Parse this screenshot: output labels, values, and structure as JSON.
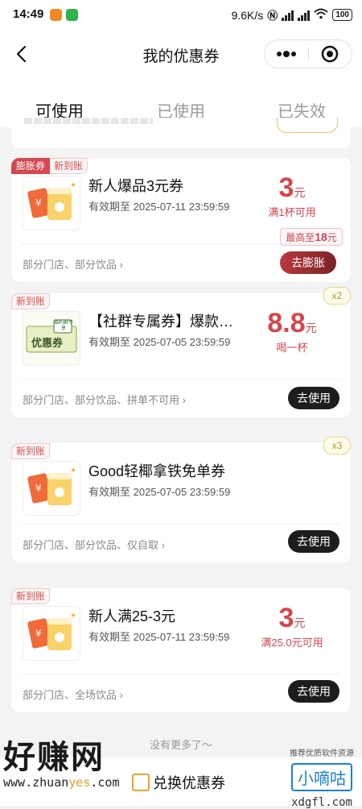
{
  "status_bar": {
    "time": "14:49",
    "net_speed": "9.6K/s",
    "battery": "100"
  },
  "nav": {
    "title": "我的优惠券"
  },
  "tabs": [
    {
      "label": "可使用",
      "active": true
    },
    {
      "label": "已使用",
      "active": false
    },
    {
      "label": "已失效",
      "active": false
    }
  ],
  "coupons": [
    {
      "tags": [
        "膨胀券",
        "新到账"
      ],
      "title": "新人爆品3元券",
      "validity": "有效期至 2025-07-11 23:59:59",
      "amount": "3",
      "unit": "元",
      "condition": "满1杯可用",
      "scope": "部分门店、部分饮品",
      "max_prefix": "最高至",
      "max_value": "18",
      "max_unit": "元",
      "button": "去膨胀",
      "icon": "cup-voucher-icon"
    },
    {
      "tags": [
        "新到账"
      ],
      "qty": "x2",
      "title": "【社群专属券】爆款…",
      "validity": "有效期至 2025-07-05 23:59:59",
      "amount": "8.8",
      "unit": "元",
      "condition": "喝一杯",
      "scope": "部分门店、部分饮品、拼单不可用",
      "thumb_tag": "福利群专享",
      "thumb_text": "优惠券",
      "button": "去使用",
      "icon": "green-ticket-icon"
    },
    {
      "tags": [
        "新到账"
      ],
      "qty": "x3",
      "title": "Good轻椰拿铁免单券",
      "validity": "有效期至 2025-07-05 23:59:59",
      "scope": "部分门店、部分饮品、仅自取",
      "button": "去使用",
      "icon": "cup-voucher-icon"
    },
    {
      "tags": [
        "新到账"
      ],
      "title": "新人满25-3元",
      "validity": "有效期至 2025-07-11 23:59:59",
      "amount": "3",
      "unit": "元",
      "condition": "满25.0元可用",
      "scope": "部分门店、全场饮品",
      "button": "去使用",
      "icon": "cup-voucher-icon"
    }
  ],
  "footer": {
    "no_more": "没有更多了～",
    "exchange": "兑换优惠券"
  },
  "watermarks": {
    "left_big": "好赚网",
    "left_url_a": "www.zhuan",
    "left_url_b": "yes",
    "left_url_c": ".com",
    "right_small": "推荐优质软件资源",
    "right_brand": "小嘀咕",
    "right_url": "xdgfl.com"
  },
  "colors": {
    "accent_red": "#d6454d",
    "button_dark": "#1d1d1d",
    "gold": "#e7c36a"
  }
}
